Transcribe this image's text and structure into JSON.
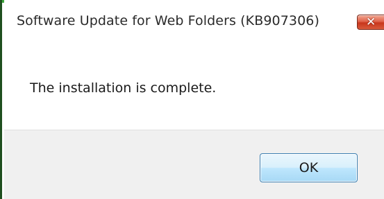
{
  "window": {
    "title": "Software Update for Web Folders (KB907306)",
    "close_symbol": "✕",
    "close_icon": "close-icon"
  },
  "dialog": {
    "message": "The installation is complete.",
    "ok_label": "OK"
  },
  "colors": {
    "footer_background": "#f0f0f0",
    "ok_button_border": "#3c7fb1",
    "close_button_red": "#c8361c"
  }
}
